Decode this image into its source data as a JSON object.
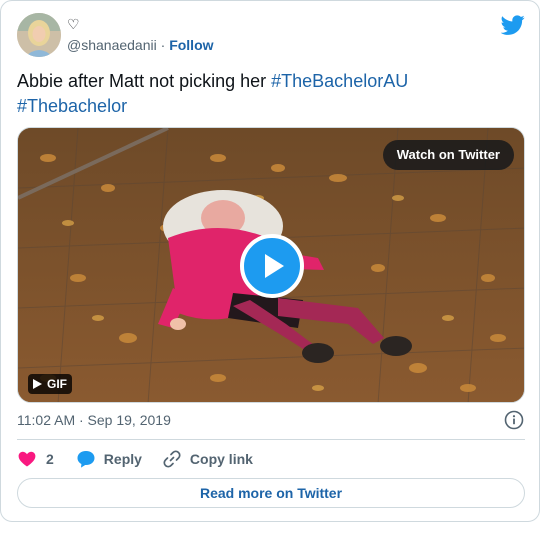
{
  "author": {
    "display_name": "♡",
    "handle": "@shanaedanii",
    "separator": "·",
    "follow_label": "Follow"
  },
  "tweet": {
    "text": "Abbie after Matt not picking her ",
    "hashtags": [
      "#TheBachelorAU",
      "#Thebachelor"
    ]
  },
  "media": {
    "watch_label": "Watch on Twitter",
    "gif_label": "GIF"
  },
  "meta": {
    "timestamp": "11:02 AM · Sep 19, 2019"
  },
  "actions": {
    "like_count": "2",
    "reply_label": "Reply",
    "copy_label": "Copy link"
  },
  "footer": {
    "read_more_label": "Read more on Twitter"
  },
  "colors": {
    "accent": "#1d9bf0",
    "link": "#1d64a8",
    "like": "#f91880",
    "muted": "#536471"
  },
  "icons": [
    "twitter-bird-icon",
    "play-icon",
    "info-icon",
    "heart-icon",
    "reply-bubble-icon",
    "link-icon"
  ]
}
